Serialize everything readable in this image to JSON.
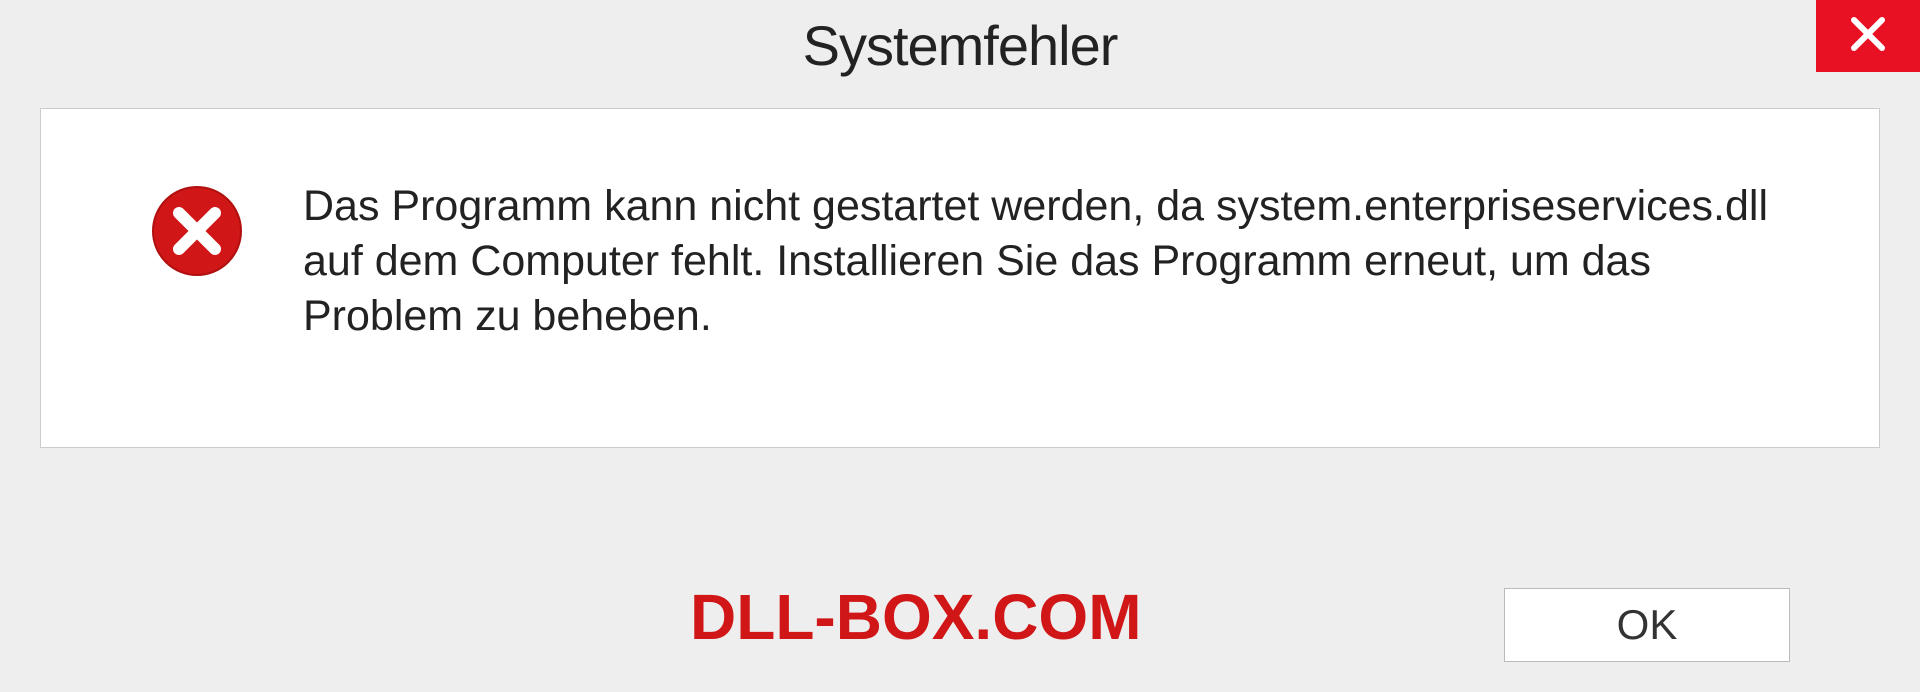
{
  "dialog": {
    "title": "Systemfehler",
    "message": "Das Programm kann nicht gestartet werden, da system.enterpriseservices.dll auf dem Computer fehlt. Installieren Sie das Programm erneut, um das Problem zu beheben.",
    "ok_label": "OK"
  },
  "watermark": "DLL-BOX.COM"
}
